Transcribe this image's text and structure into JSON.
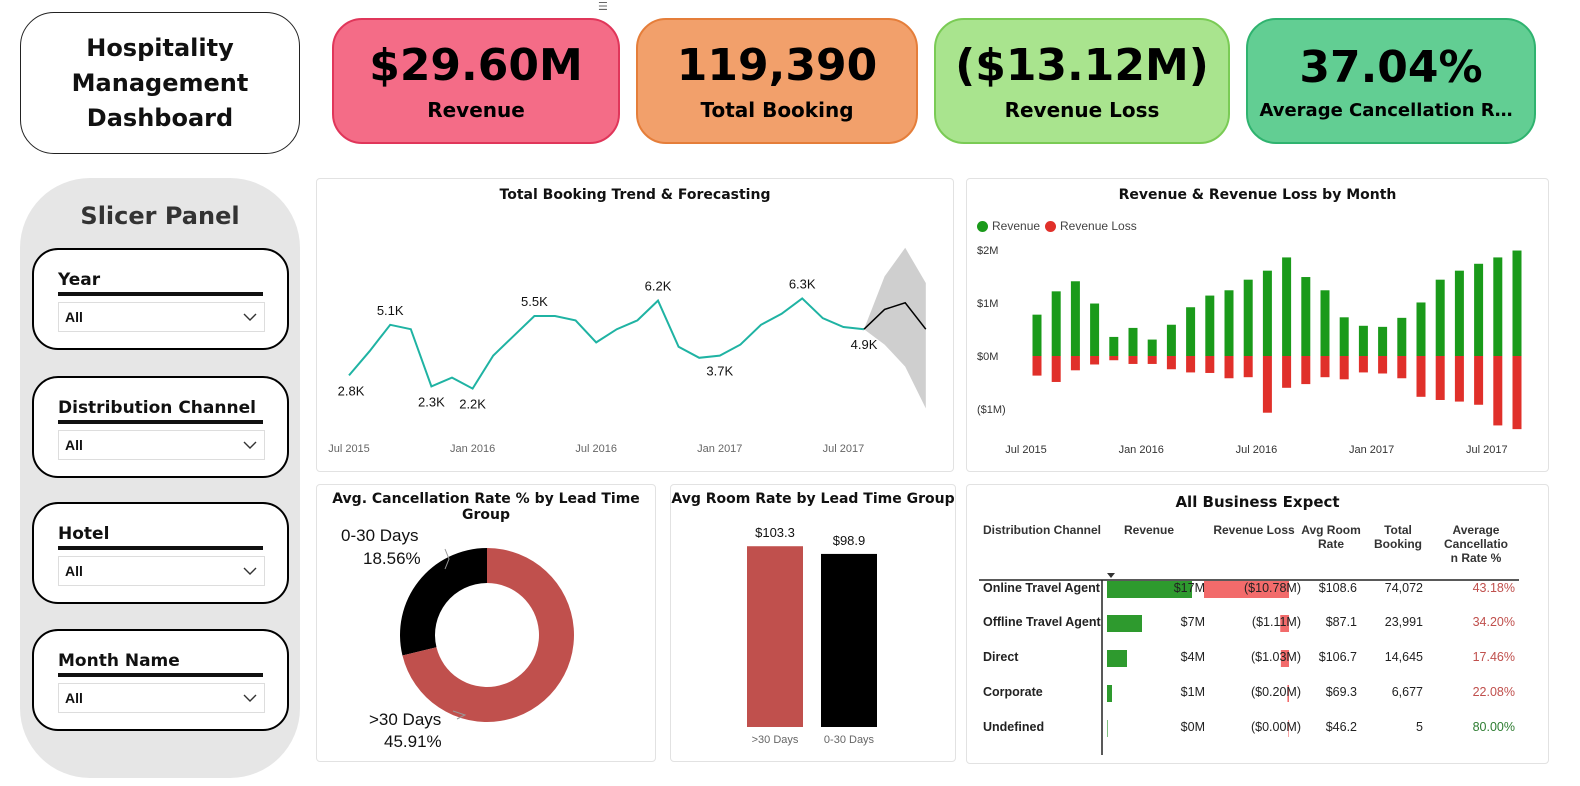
{
  "title": {
    "text": "Hospitality\nManagement\nDashboard"
  },
  "kpis": [
    {
      "value": "$29.60M",
      "label": "Revenue",
      "bg": "#f46c87",
      "border": "#e0365a"
    },
    {
      "value": "119,390",
      "label": "Total Booking",
      "bg": "#f2a06b",
      "border": "#e57e3a"
    },
    {
      "value": "($13.12M)",
      "label": "Revenue Loss",
      "bg": "#a9e48e",
      "border": "#7acb55"
    },
    {
      "value": "37.04%",
      "label": "Average Cancellation Rat...",
      "bg": "#62ce93",
      "border": "#2fb36f"
    }
  ],
  "slicer_panel": {
    "title": "Slicer Panel",
    "slicers": [
      {
        "label": "Year",
        "value": "All"
      },
      {
        "label": "Distribution Channel",
        "value": "All"
      },
      {
        "label": "Hotel",
        "value": "All"
      },
      {
        "label": "Month Name",
        "value": "All"
      }
    ]
  },
  "charts": {
    "trend": {
      "title": "Total Booking Trend & Forecasting"
    },
    "revenue_month": {
      "title": "Revenue & Revenue Loss by Month",
      "legend": [
        "Revenue",
        "Revenue Loss"
      ]
    },
    "cancel_donut": {
      "title": "Avg. Cancellation Rate % by Lead Time Group"
    },
    "room_rate": {
      "title": "Avg Room Rate by Lead Time Group"
    }
  },
  "chart_data": [
    {
      "type": "line",
      "title": "Total Booking Trend & Forecasting",
      "x_tick_labels": [
        "Jul 2015",
        "Jan 2016",
        "Jul 2016",
        "Jan 2017",
        "Jul 2017"
      ],
      "x": [
        "2015-07",
        "2015-08",
        "2015-09",
        "2015-10",
        "2015-11",
        "2015-12",
        "2016-01",
        "2016-02",
        "2016-03",
        "2016-04",
        "2016-05",
        "2016-06",
        "2016-07",
        "2016-08",
        "2016-09",
        "2016-10",
        "2016-11",
        "2016-12",
        "2017-01",
        "2017-02",
        "2017-03",
        "2017-04",
        "2017-05",
        "2017-06",
        "2017-07",
        "2017-08"
      ],
      "values": [
        2.8,
        3.9,
        5.1,
        4.9,
        2.3,
        2.7,
        2.2,
        3.7,
        4.6,
        5.5,
        5.5,
        5.3,
        4.3,
        4.9,
        5.3,
        6.2,
        4.1,
        3.6,
        3.7,
        4.2,
        5.1,
        5.6,
        6.3,
        5.4,
        5.0,
        4.9
      ],
      "data_labels": [
        {
          "index": 0,
          "text": "2.8K"
        },
        {
          "index": 2,
          "text": "5.1K"
        },
        {
          "index": 4,
          "text": "2.3K"
        },
        {
          "index": 6,
          "text": "2.2K"
        },
        {
          "index": 9,
          "text": "5.5K"
        },
        {
          "index": 15,
          "text": "6.2K"
        },
        {
          "index": 18,
          "text": "3.7K"
        },
        {
          "index": 22,
          "text": "6.3K"
        },
        {
          "index": 25,
          "text": "4.9K"
        }
      ],
      "forecast": {
        "x": [
          "2017-08",
          "2017-09",
          "2017-10",
          "2017-11"
        ],
        "values": [
          4.9,
          5.8,
          6.1,
          4.9
        ],
        "upper": [
          4.9,
          7.3,
          8.6,
          7.0
        ],
        "lower": [
          4.9,
          4.2,
          3.2,
          1.3
        ]
      },
      "ylim": [
        0,
        9
      ]
    },
    {
      "type": "bar",
      "title": "Revenue & Revenue Loss by Month",
      "x_tick_labels": [
        "Jul 2015",
        "Jan 2016",
        "Jul 2016",
        "Jan 2017",
        "Jul 2017"
      ],
      "y_tick_labels": [
        "$2M",
        "$1M",
        "$0M",
        "($1M)"
      ],
      "ylim": [
        -1.4,
        2.1
      ],
      "series": [
        {
          "name": "Revenue",
          "color": "#1a9a1a",
          "values": [
            0.78,
            1.22,
            1.41,
            0.99,
            0.36,
            0.53,
            0.31,
            0.59,
            0.92,
            1.14,
            1.24,
            1.44,
            1.61,
            1.86,
            1.49,
            1.24,
            0.73,
            0.57,
            0.55,
            0.72,
            1.01,
            1.44,
            1.61,
            1.74,
            1.86,
            1.99
          ]
        },
        {
          "name": "Revenue Loss",
          "color": "#e0302a",
          "values": [
            -0.37,
            -0.49,
            -0.27,
            -0.16,
            -0.08,
            -0.15,
            -0.15,
            -0.25,
            -0.31,
            -0.32,
            -0.42,
            -0.4,
            -1.07,
            -0.6,
            -0.53,
            -0.4,
            -0.44,
            -0.31,
            -0.33,
            -0.42,
            -0.77,
            -0.83,
            -0.86,
            -0.92,
            -1.31,
            -1.38
          ]
        }
      ]
    },
    {
      "type": "pie",
      "title": "Avg. Cancellation Rate % by Lead Time Group",
      "categories": [
        "0-30 Days",
        ">30 Days"
      ],
      "values": [
        18.56,
        45.91
      ],
      "labels": [
        "18.56%",
        "45.91%"
      ],
      "colors": [
        "#000000",
        "#c0504d"
      ]
    },
    {
      "type": "bar",
      "title": "Avg Room Rate by Lead Time Group",
      "categories": [
        ">30 Days",
        "0-30 Days"
      ],
      "values": [
        103.3,
        98.9
      ],
      "labels": [
        "$103.3",
        "$98.9"
      ],
      "colors": [
        "#c0504d",
        "#000000"
      ]
    }
  ],
  "table": {
    "title": "All Business Expect",
    "headers": [
      "Distribution Channel",
      "Revenue",
      "Revenue Loss",
      "Avg Room\nRate",
      "Total\nBooking",
      "Average\nCancellatio\nn Rate %"
    ],
    "revenue_max": 17,
    "loss_max": 10.78,
    "rows": [
      {
        "channel": "Online Travel Agent",
        "revenue": "$17M",
        "revenue_value": 17,
        "loss": "($10.78M)",
        "loss_value": 10.78,
        "rate": "$108.6",
        "booking": "74,072",
        "cancel": "43.18%"
      },
      {
        "channel": "Offline Travel Agent",
        "revenue": "$7M",
        "revenue_value": 7,
        "loss": "($1.11M)",
        "loss_value": 1.11,
        "rate": "$87.1",
        "booking": "23,991",
        "cancel": "34.20%"
      },
      {
        "channel": "Direct",
        "revenue": "$4M",
        "revenue_value": 4,
        "loss": "($1.03M)",
        "loss_value": 1.03,
        "rate": "$106.7",
        "booking": "14,645",
        "cancel": "17.46%"
      },
      {
        "channel": "Corporate",
        "revenue": "$1M",
        "revenue_value": 1,
        "loss": "($0.20M)",
        "loss_value": 0.2,
        "rate": "$69.3",
        "booking": "6,677",
        "cancel": "22.08%"
      },
      {
        "channel": "Undefined",
        "revenue": "$0M",
        "revenue_value": 0,
        "loss": "($0.00M)",
        "loss_value": 0,
        "rate": "$46.2",
        "booking": "5",
        "cancel": "80.00%"
      }
    ],
    "bar_colors": {
      "revenue": "#2e9a2e",
      "loss": "#f26b6b"
    }
  }
}
